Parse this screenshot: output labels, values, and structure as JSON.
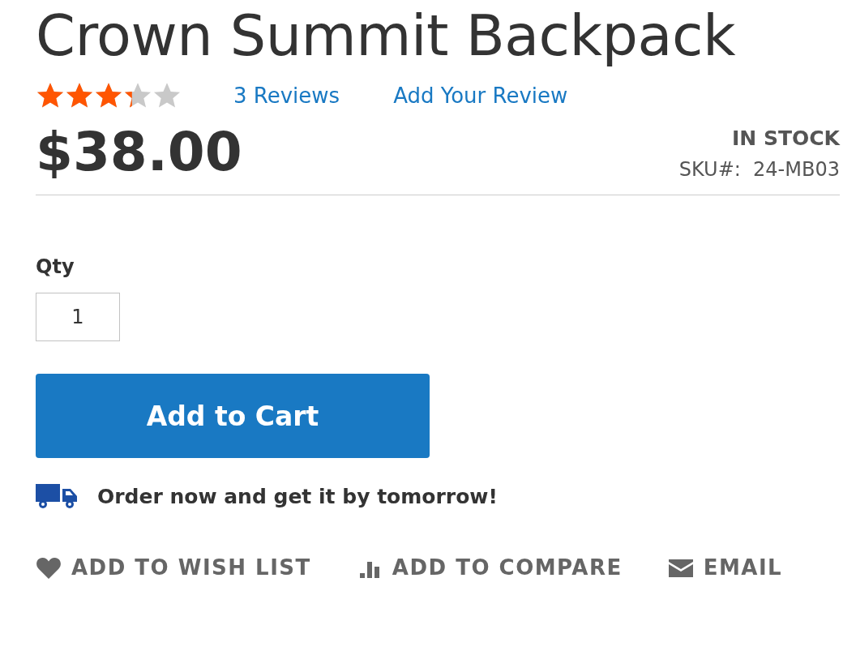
{
  "product": {
    "title": "Crown Summit Backpack",
    "rating": {
      "stars": 3.3,
      "reviews_link": "3  Reviews",
      "add_review_link": "Add Your Review"
    },
    "price": "$38.00",
    "stock": "IN STOCK",
    "sku_label": "SKU#:",
    "sku": "24-MB03",
    "qty": {
      "label": "Qty",
      "value": "1"
    },
    "add_to_cart": "Add to Cart",
    "delivery_note": "Order now and get it by tomorrow!",
    "actions": [
      {
        "kind": "wishlist",
        "label": "ADD TO WISH LIST"
      },
      {
        "kind": "compare",
        "label": "ADD TO COMPARE"
      },
      {
        "kind": "email",
        "label": "EMAIL"
      }
    ]
  }
}
